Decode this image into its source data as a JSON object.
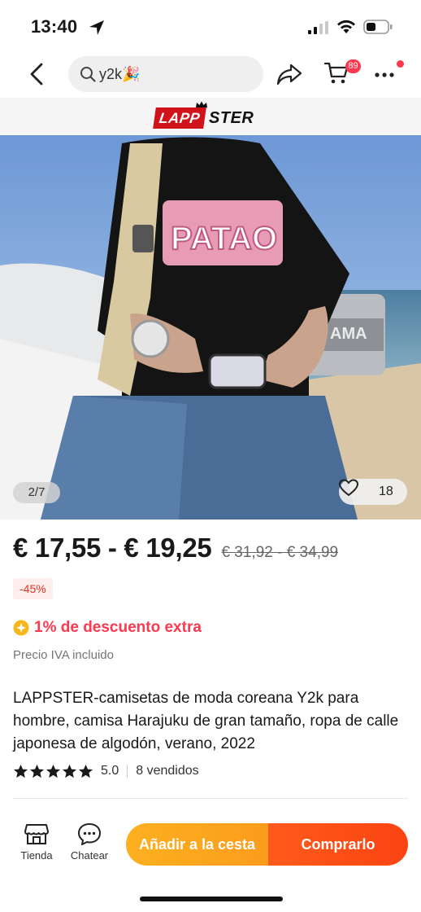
{
  "status_bar": {
    "time": "13:40"
  },
  "nav": {
    "search_value": "y2k🎉",
    "cart_badge": "89"
  },
  "store": {
    "logo_red": "LAPP",
    "logo_black": "STER"
  },
  "gallery": {
    "counter": "2/7",
    "wishlist_count": "18",
    "shirt_print": "PATAO",
    "boat_text": "AMA"
  },
  "price": {
    "range": "€ 17,55 - € 19,25",
    "original": "€ 31,92 - € 34,99",
    "discount": "-45%",
    "extra": "1% de descuento extra",
    "vat": "Precio IVA incluido"
  },
  "product": {
    "title": "LAPPSTER-camisetas de moda coreana Y2k para hombre, camisa Harajuku de gran tamaño, ropa de calle japonesa de algodón, verano, 2022",
    "rating": "5.0",
    "stars": 5,
    "sold": "8 vendidos"
  },
  "bottom": {
    "store_label": "Tienda",
    "chat_label": "Chatear",
    "cart_label": "Añadir a la cesta",
    "buy_label": "Comprarlo"
  },
  "colors": {
    "accent_red": "#fd384f",
    "cart_orange": "#fdb020",
    "buy_orange": "#ff5a1c",
    "discount_text": "#e0361e"
  }
}
